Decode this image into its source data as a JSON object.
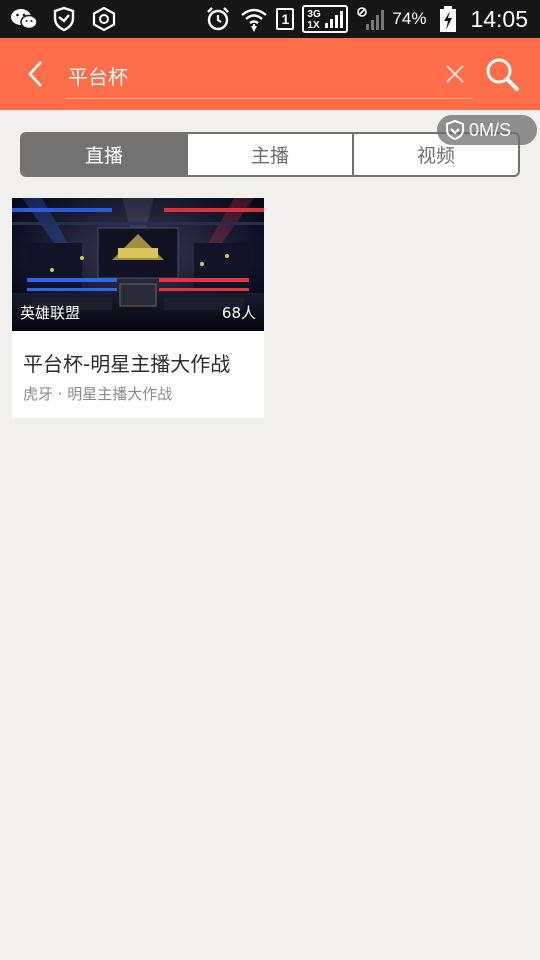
{
  "status_bar": {
    "battery_percent": "74%",
    "time": "14:05",
    "sim_slot": "1",
    "network_top": "3G",
    "network_bottom": "1X",
    "icons": [
      "wechat-icon",
      "shield-app-icon",
      "hexagon-app-icon",
      "alarm-icon",
      "wifi-icon",
      "sim-icon",
      "network-type-icon",
      "no-sim-signal-icon",
      "battery-icon"
    ]
  },
  "header": {
    "query": "平台杯",
    "back_icon": "chevron-left-icon",
    "clear_icon": "close-icon",
    "search_icon": "search-icon",
    "background": "#ff6e4b"
  },
  "speed_indicator": {
    "label": "0M/S",
    "icon": "shield-heart-icon"
  },
  "tabs": [
    {
      "label": "直播",
      "active": true
    },
    {
      "label": "主播",
      "active": false
    },
    {
      "label": "视频",
      "active": false
    }
  ],
  "results": [
    {
      "category": "英雄联盟",
      "viewers": "68人",
      "title": "平台杯-明星主播大作战",
      "subtitle": "虎牙 · 明星主播大作战"
    }
  ],
  "colors": {
    "accent": "#ff6e4b",
    "tab_active": "#727272",
    "page_bg": "#f2f0ee"
  }
}
